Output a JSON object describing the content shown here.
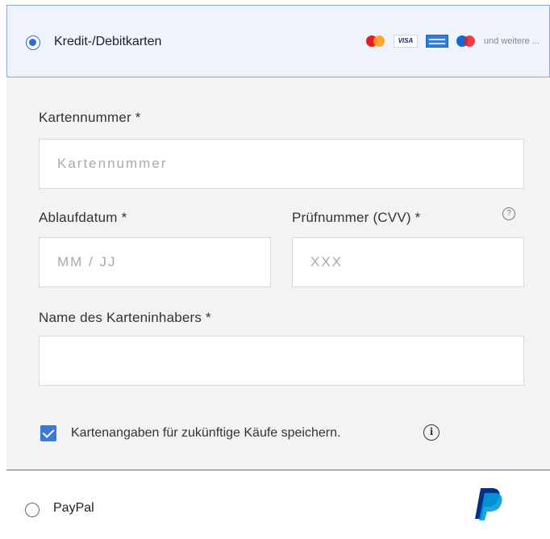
{
  "payment_options": {
    "card": {
      "label": "Kredit-/Debitkarten",
      "selected": true,
      "logos": [
        "mastercard-icon",
        "visa-icon",
        "amex-icon",
        "maestro-icon"
      ],
      "visa_text": "VISA",
      "more_text": "und weitere ..."
    },
    "paypal": {
      "label": "PayPal",
      "selected": false,
      "logo": "paypal-icon"
    }
  },
  "form": {
    "card_number": {
      "label": "Kartennummer *",
      "placeholder": "Kartennummer",
      "value": ""
    },
    "expiry": {
      "label": "Ablaufdatum *",
      "placeholder": "MM / JJ",
      "value": ""
    },
    "cvv": {
      "label": "Prüfnummer (CVV) *",
      "placeholder": "XXX",
      "value": "",
      "help_icon": "question-circle-icon",
      "help_glyph": "?"
    },
    "holder": {
      "label": "Name des Karteninhabers *",
      "placeholder": "",
      "value": ""
    },
    "save_card": {
      "label": "Kartenangaben für zukünftige Käufe speichern.",
      "checked": true,
      "info_icon": "info-circle-icon",
      "info_glyph": "i"
    }
  },
  "colors": {
    "accent": "#2f6bd8",
    "selected_bg": "#eef3fd",
    "form_bg": "#f3f3f3",
    "checkbox": "#3a79d6",
    "paypal_dark": "#003087",
    "paypal_light": "#009cde"
  }
}
